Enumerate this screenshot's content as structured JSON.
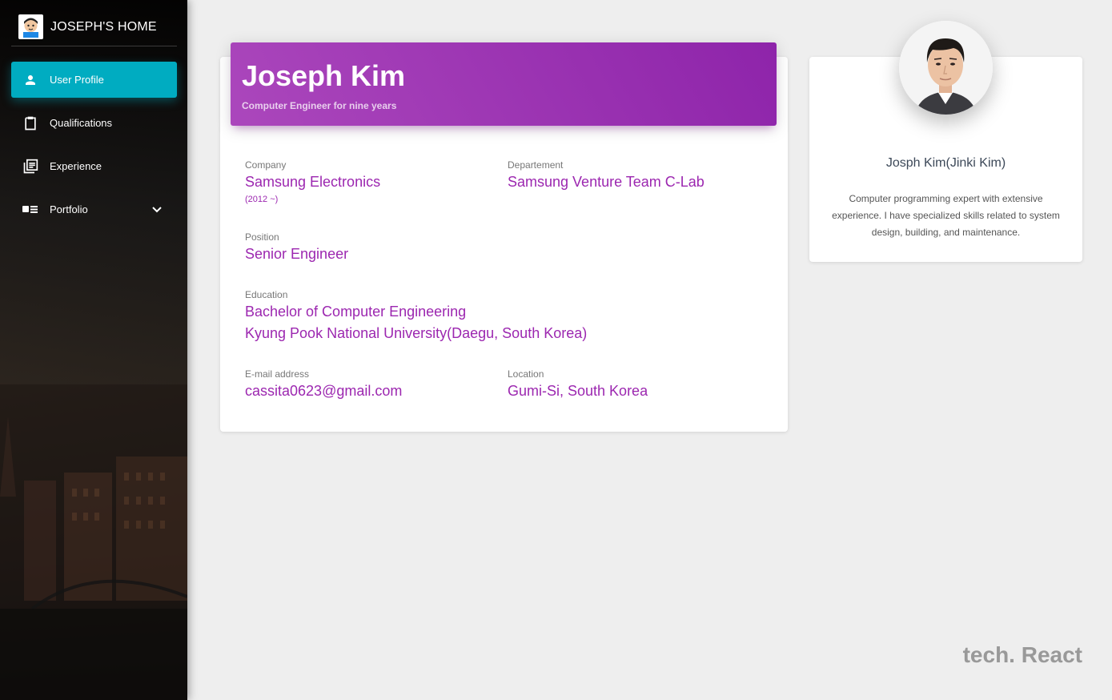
{
  "sidebar": {
    "brand": "JOSEPH'S HOME",
    "items": [
      {
        "label": "User Profile",
        "icon": "person-icon",
        "active": true
      },
      {
        "label": "Qualifications",
        "icon": "clipboard-icon",
        "active": false
      },
      {
        "label": "Experience",
        "icon": "library-books-icon",
        "active": false
      },
      {
        "label": "Portfolio",
        "icon": "portfolio-icon",
        "active": false
      }
    ],
    "accent": "#00acc1"
  },
  "profile": {
    "name": "Joseph Kim",
    "subtitle": "Computer Engineer for nine years",
    "header_color": "#9c27b0",
    "company_label": "Company",
    "company": "Samsung Electronics",
    "company_since": "(2012 ~)",
    "department_label": "Departement",
    "department": "Samsung Venture Team C-Lab",
    "position_label": "Position",
    "position": "Senior Engineer",
    "education_label": "Education",
    "education_degree": "Bachelor of Computer Engineering",
    "education_school": "Kyung Pook National University(Daegu, South Korea)",
    "email_label": "E-mail address",
    "email": "cassita0623@gmail.com",
    "location_label": "Location",
    "location": "Gumi-Si, South Korea"
  },
  "side_card": {
    "name": "Josph Kim(Jinki Kim)",
    "description": "Computer programming expert with extensive experience. I have specialized skills related to system design, building, and maintenance."
  },
  "footer": {
    "tech": "tech. React"
  }
}
